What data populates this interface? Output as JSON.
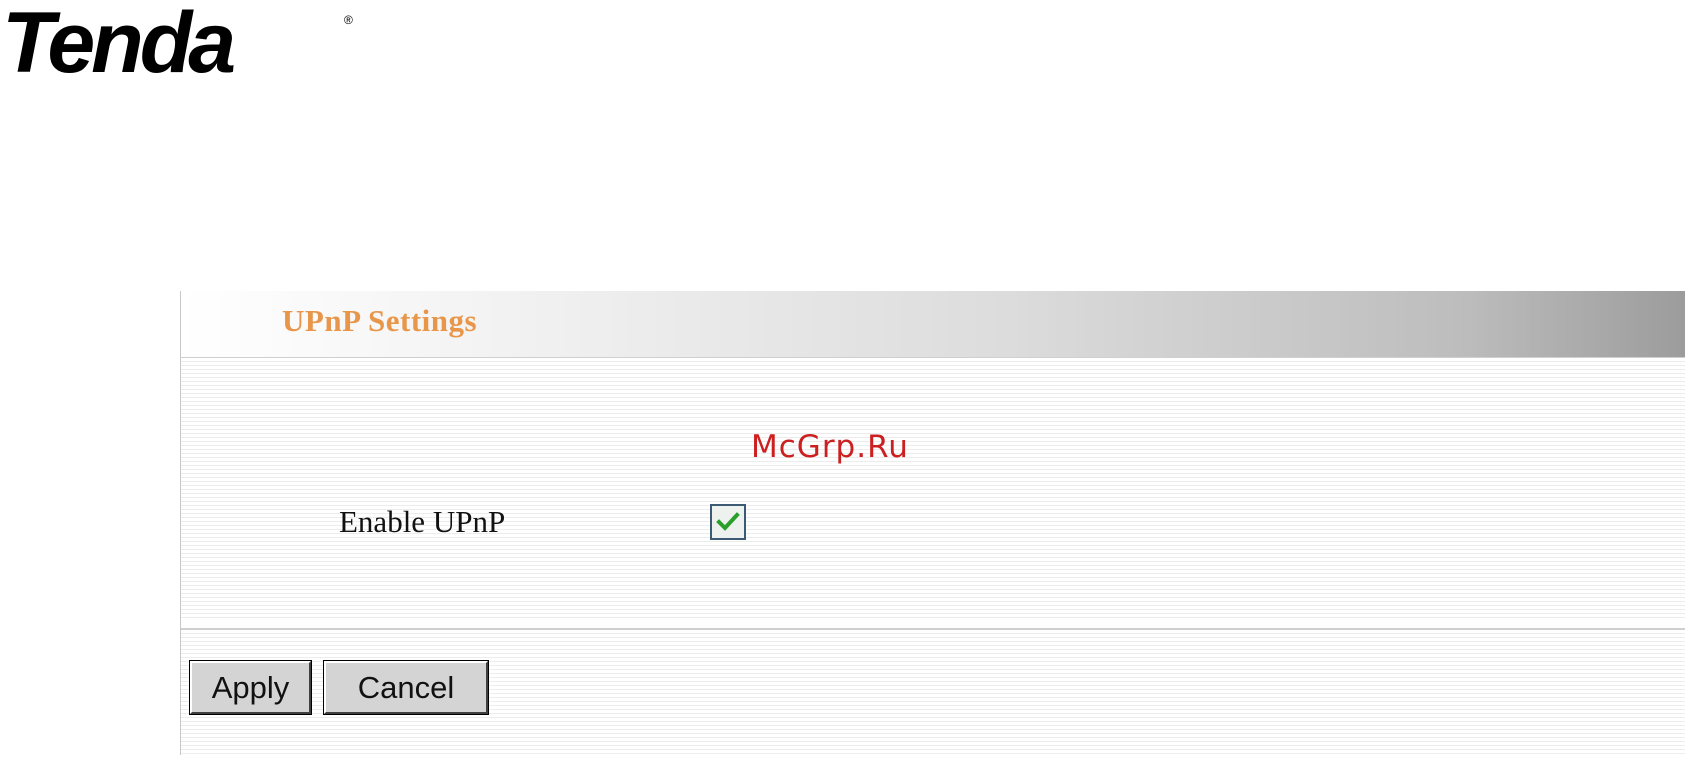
{
  "brand": {
    "logo_text": "Tenda",
    "registered_mark": "®"
  },
  "panel": {
    "title": "UPnP Settings",
    "watermark": "McGrp.Ru",
    "enable_upnp_label": "Enable UPnP",
    "enable_upnp_checked": true
  },
  "buttons": {
    "apply": "Apply",
    "cancel": "Cancel"
  },
  "colors": {
    "title": "#e8974a",
    "watermark": "#cc1f1f",
    "checkmark": "#2aa02a"
  },
  "icons": {
    "checkbox": "checkmark-icon"
  }
}
